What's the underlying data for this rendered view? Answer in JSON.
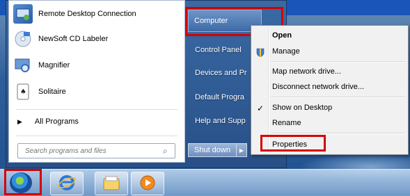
{
  "start_menu": {
    "programs": [
      {
        "label": "Remote Desktop Connection",
        "icon": "remote-desktop-icon"
      },
      {
        "label": "NewSoft CD Labeler",
        "icon": "cd-labeler-icon"
      },
      {
        "label": "Magnifier",
        "icon": "magnifier-icon"
      },
      {
        "label": "Solitaire",
        "icon": "solitaire-icon"
      }
    ],
    "all_programs": "All Programs",
    "search_placeholder": "Search programs and files",
    "right_items": [
      "Computer",
      "Control Panel",
      "Devices and Pr",
      "Default Progra",
      "Help and Supp"
    ],
    "shutdown": "Shut down"
  },
  "context_menu": {
    "items": [
      {
        "label": "Open",
        "bold": true
      },
      {
        "label": "Manage",
        "icon": "shield-icon"
      },
      {
        "label": "Map network drive..."
      },
      {
        "label": "Disconnect network drive..."
      },
      {
        "label": "Show on Desktop",
        "icon": "checkmark-icon"
      },
      {
        "label": "Rename"
      },
      {
        "label": "Properties"
      }
    ]
  },
  "taskbar": {
    "buttons": [
      "internet-explorer-icon",
      "windows-explorer-icon",
      "media-player-icon"
    ]
  },
  "colors": {
    "highlight": "#d40000",
    "accent": "#1a56b8"
  }
}
